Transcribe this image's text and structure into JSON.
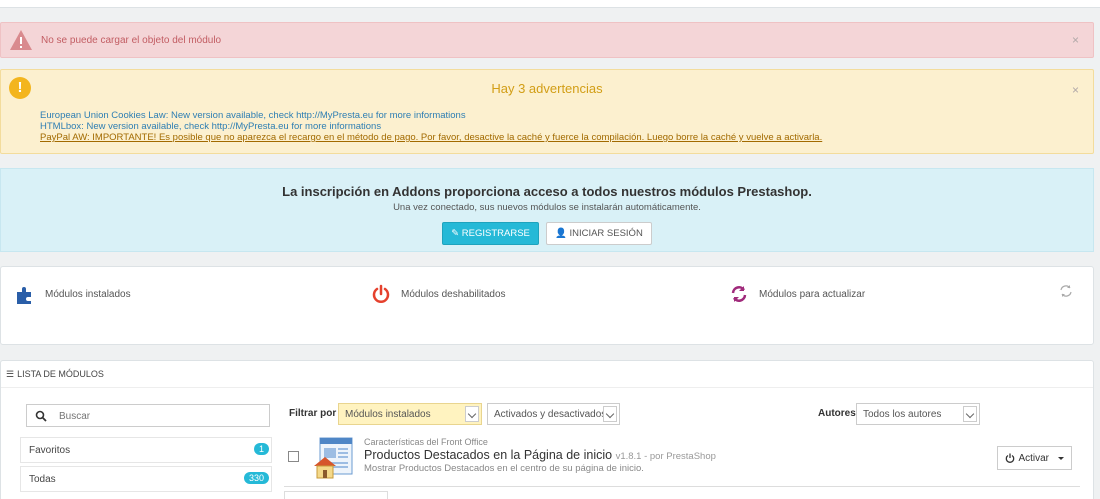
{
  "alerts": {
    "error": {
      "message": "No se puede cargar el objeto del módulo",
      "close": "×"
    },
    "warning": {
      "title": "Hay 3 advertencias",
      "close": "×",
      "lines": [
        "European Union Cookies Law: New version available, check http://MyPresta.eu for more informations",
        "HTMLbox: New version available, check http://MyPresta.eu for more informations",
        "PayPal AW: IMPORTANTE! Es posible que no aparezca el recargo en el método de pago. Por favor, desactive la caché y fuerce la compilación. Luego borre la caché y vuelve a activarla."
      ]
    }
  },
  "addons": {
    "headline": "La inscripción en Addons proporciona acceso a todos nuestros módulos Prestashop.",
    "subline": "Una vez conectado, sus nuevos módulos se instalarán automáticamente.",
    "register_label": "REGISTRARSE",
    "login_label": "INICIAR SESIÓN"
  },
  "stats": {
    "installed": "Módulos instalados",
    "disabled": "Módulos deshabilitados",
    "to_update": "Módulos para actualizar"
  },
  "module_list": {
    "header": "LISTA DE MÓDULOS",
    "search_placeholder": "Buscar",
    "categories": [
      {
        "label": "Favoritos",
        "count": "1"
      },
      {
        "label": "Todas",
        "count": "330"
      }
    ],
    "filter_label": "Filtrar por",
    "filter_installed": "Módulos instalados",
    "filter_status": "Activados y desactivados",
    "authors_label": "Autores",
    "authors_value": "Todos los autores",
    "modules": [
      {
        "category": "Características del Front Office",
        "name": "Productos Destacados en la Página de inicio",
        "version": "v1.8.1 - por PrestaShop",
        "description": "Mostrar Productos Destacados en el centro de su página de inicio.",
        "action": "Activar"
      }
    ]
  },
  "colors": {
    "danger": "#f4d5d7",
    "warning": "#fcf0cf",
    "info": "#d9f1f7",
    "accent": "#25b9d7"
  }
}
